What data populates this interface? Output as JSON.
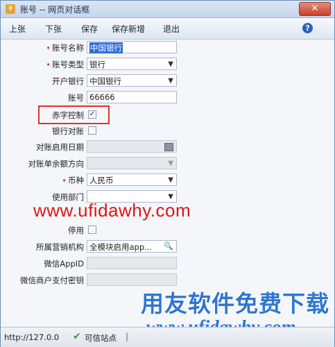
{
  "window": {
    "title": "账号 -- 网页对话框",
    "close_label": "✕"
  },
  "toolbar": {
    "buttons": [
      "上张",
      "下张",
      "保存",
      "保存新增",
      "退出"
    ],
    "help_label": "?"
  },
  "form": {
    "account_name": {
      "label": "账号名称",
      "value": "中国银行"
    },
    "account_type": {
      "label": "账号类型",
      "value": "银行"
    },
    "bank": {
      "label": "开户银行",
      "value": "中国银行"
    },
    "account_no": {
      "label": "账号",
      "value": "66666"
    },
    "red_control": {
      "label": "赤字控制",
      "checked": true,
      "mark": "✓"
    },
    "bank_reconcile": {
      "label": "银行对账",
      "checked": false
    },
    "reconcile_start_date": {
      "label": "对账启用日期",
      "value": ""
    },
    "statement_direction": {
      "label": "对账单余额方向",
      "value": ""
    },
    "currency": {
      "label": "币种",
      "value": "人民币"
    },
    "department": {
      "label": "使用部门",
      "value": ""
    },
    "stop_use": {
      "label": "停用",
      "checked": false
    },
    "sales_org": {
      "label": "所属营销机构",
      "value": "全模块启用app..."
    },
    "wechat_appid": {
      "label": "微信AppID",
      "value": ""
    },
    "wechat_pay_key": {
      "label": "微信商户支付密钥",
      "value": ""
    }
  },
  "watermarks": {
    "url_red": "www.ufidawhy.com",
    "brand_blue": "用友软件免费下载",
    "url_blue": "www.ufidawhy.com"
  },
  "status_bar": {
    "url": "http://127.0.0",
    "trust_label": "可信站点"
  }
}
